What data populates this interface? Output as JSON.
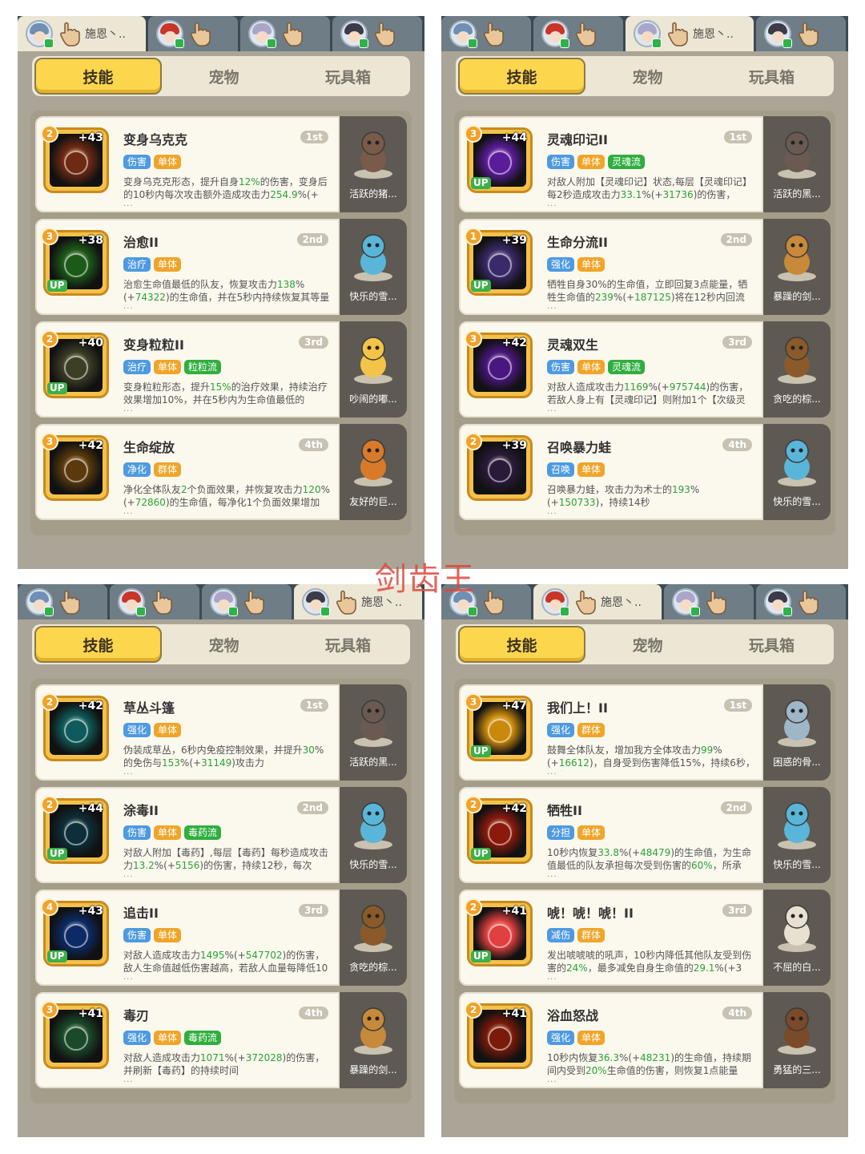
{
  "nav_tabs": [
    "技能",
    "宠物",
    "玩具箱"
  ],
  "watermark": "剑齿王",
  "panels": [
    {
      "active_char": 0,
      "char_name": "施恩丶..",
      "cards": [
        {
          "name": "变身乌克克",
          "rank": "1st",
          "level": "2",
          "plus": "+43",
          "up": false,
          "tags": [
            [
              "伤害",
              "blue"
            ],
            [
              "单体",
              "orange"
            ]
          ],
          "desc": [
            [
              "变身乌克克形态，提升自身",
              ""
            ],
            [
              "12%",
              "g"
            ],
            [
              "的伤害，变身后的10秒内每次攻击额外造成攻击力",
              ""
            ],
            [
              "254.9",
              "g"
            ],
            [
              "%(+",
              ""
            ]
          ],
          "pet": "活跃的猪...",
          "icon_color": "#6e2a12",
          "pet_color": "#7a5a48"
        },
        {
          "name": "治愈II",
          "rank": "2nd",
          "level": "3",
          "plus": "+38",
          "up": true,
          "tags": [
            [
              "治疗",
              "blue"
            ],
            [
              "单体",
              "orange"
            ]
          ],
          "desc": [
            [
              "治愈生命值最低的队友，恢复攻击力",
              ""
            ],
            [
              "138",
              "g"
            ],
            [
              "%(+",
              ""
            ],
            [
              "74322",
              "g"
            ],
            [
              ")的生命值，并在5秒内持续恢复其等量的",
              ""
            ]
          ],
          "pet": "快乐的雪...",
          "icon_color": "#1c5a18",
          "pet_color": "#59b6d8"
        },
        {
          "name": "变身粒粒II",
          "rank": "3rd",
          "level": "2",
          "plus": "+40",
          "up": true,
          "tags": [
            [
              "治疗",
              "blue"
            ],
            [
              "单体",
              "orange"
            ],
            [
              "粒粒流",
              "green"
            ]
          ],
          "desc": [
            [
              "变身粒粒形态，提升",
              ""
            ],
            [
              "15%",
              "g"
            ],
            [
              "的治疗效果，持续治疗效果增加10%，并在5秒内为生命值最低的",
              ""
            ]
          ],
          "pet": "吵闹的嘟...",
          "icon_color": "#3c3e26",
          "pet_color": "#f3c447"
        },
        {
          "name": "生命绽放",
          "rank": "4th",
          "level": "3",
          "plus": "+42",
          "up": false,
          "tags": [
            [
              "净化",
              "blue"
            ],
            [
              "群体",
              "orange"
            ]
          ],
          "desc": [
            [
              "净化全体队友",
              ""
            ],
            [
              "2",
              "g"
            ],
            [
              "个负面效果，并恢复攻击力",
              ""
            ],
            [
              "120",
              "g"
            ],
            [
              "%(+",
              ""
            ],
            [
              "72860",
              "g"
            ],
            [
              ")的生命值，每净化1个负面效果增加",
              ""
            ]
          ],
          "pet": "友好的巨...",
          "icon_color": "#5a3a0c",
          "pet_color": "#d97a2a"
        }
      ]
    },
    {
      "active_char": 2,
      "char_name": "施恩丶..",
      "cards": [
        {
          "name": "灵魂印记II",
          "rank": "1st",
          "level": "3",
          "plus": "+44",
          "up": true,
          "tags": [
            [
              "伤害",
              "blue"
            ],
            [
              "单体",
              "orange"
            ],
            [
              "灵魂流",
              "green"
            ]
          ],
          "desc": [
            [
              "对敌人附加【灵魂印记】状态,每层【灵魂印记】每2秒造成攻击力",
              ""
            ],
            [
              "33.1",
              "g"
            ],
            [
              "%(+",
              ""
            ],
            [
              "31736",
              "g"
            ],
            [
              ")的伤害，",
              ""
            ]
          ],
          "pet": "活跃的黑...",
          "icon_color": "#5a1c9a",
          "pet_color": "#6a5a52"
        },
        {
          "name": "生命分流II",
          "rank": "2nd",
          "level": "1",
          "plus": "+39",
          "up": true,
          "tags": [
            [
              "强化",
              "blue"
            ],
            [
              "单体",
              "orange"
            ]
          ],
          "desc": [
            [
              "牺牲自身30%的生命值，立即回复3点能量，牺牲生命值的",
              ""
            ],
            [
              "239",
              "g"
            ],
            [
              "%(+",
              ""
            ],
            [
              "187125",
              "g"
            ],
            [
              ")将在12秒内回流",
              ""
            ]
          ],
          "pet": "暴躁的剑...",
          "icon_color": "#3a2a6a",
          "pet_color": "#c7893a"
        },
        {
          "name": "灵魂双生",
          "rank": "3rd",
          "level": "3",
          "plus": "+42",
          "up": false,
          "tags": [
            [
              "伤害",
              "blue"
            ],
            [
              "单体",
              "orange"
            ],
            [
              "灵魂流",
              "green"
            ]
          ],
          "desc": [
            [
              "对敌人造成攻击力",
              ""
            ],
            [
              "1169",
              "g"
            ],
            [
              "%(+",
              ""
            ],
            [
              "975744",
              "g"
            ],
            [
              ")的伤害，若敌人身上有【灵魂印记】则附加1个【次级灵",
              ""
            ]
          ],
          "pet": "贪吃的棕...",
          "icon_color": "#4a1680",
          "pet_color": "#8b5a2a"
        },
        {
          "name": "召唤暴力蛙",
          "rank": "4th",
          "level": "2",
          "plus": "+39",
          "up": false,
          "tags": [
            [
              "召唤",
              "blue"
            ],
            [
              "单体",
              "orange"
            ]
          ],
          "desc": [
            [
              "召唤暴力蛙，攻击力为术士的",
              ""
            ],
            [
              "193",
              "g"
            ],
            [
              "%(+",
              ""
            ],
            [
              "150733",
              "g"
            ],
            [
              ")，持续14秒",
              ""
            ]
          ],
          "pet": "快乐的雪...",
          "icon_color": "#2a1a3a",
          "pet_color": "#59b6d8"
        }
      ]
    },
    {
      "active_char": 3,
      "char_name": "施恩丶..",
      "cards": [
        {
          "name": "草丛斗篷",
          "rank": "1st",
          "level": "2",
          "plus": "+42",
          "up": false,
          "tags": [
            [
              "强化",
              "blue"
            ],
            [
              "单体",
              "orange"
            ]
          ],
          "desc": [
            [
              "伪装成草丛，6秒内免疫控制效果，并提升",
              ""
            ],
            [
              "30",
              "g"
            ],
            [
              "%的免伤与",
              ""
            ],
            [
              "153",
              "g"
            ],
            [
              "%(+",
              ""
            ],
            [
              "31149",
              "g"
            ],
            [
              ")攻击力",
              ""
            ]
          ],
          "pet": "活跃的黑...",
          "icon_color": "#0f5a5a",
          "pet_color": "#6a5a52"
        },
        {
          "name": "涂毒II",
          "rank": "2nd",
          "level": "2",
          "plus": "+44",
          "up": true,
          "tags": [
            [
              "伤害",
              "blue"
            ],
            [
              "单体",
              "orange"
            ],
            [
              "毒药流",
              "green"
            ]
          ],
          "desc": [
            [
              "对敌人附加【毒药】,每层【毒药】每秒造成攻击力",
              ""
            ],
            [
              "13.2",
              "g"
            ],
            [
              "%(+",
              ""
            ],
            [
              "5156",
              "g"
            ],
            [
              ")的伤害，持续12秒，每次",
              ""
            ]
          ],
          "pet": "快乐的雪...",
          "icon_color": "#0d2f3a",
          "pet_color": "#59b6d8"
        },
        {
          "name": "追击II",
          "rank": "3rd",
          "level": "4",
          "plus": "+43",
          "up": true,
          "tags": [
            [
              "伤害",
              "blue"
            ],
            [
              "单体",
              "orange"
            ]
          ],
          "desc": [
            [
              "对敌人造成攻击力",
              ""
            ],
            [
              "1495",
              "g"
            ],
            [
              "%(+",
              ""
            ],
            [
              "547702",
              "g"
            ],
            [
              ")的伤害，敌人生命值越低伤害越高，若敌人血量每降低10",
              ""
            ]
          ],
          "pet": "贪吃的棕...",
          "icon_color": "#0c2a66",
          "pet_color": "#8b5a2a"
        },
        {
          "name": "毒刃",
          "rank": "4th",
          "level": "3",
          "plus": "+41",
          "up": false,
          "tags": [
            [
              "强化",
              "blue"
            ],
            [
              "单体",
              "orange"
            ],
            [
              "毒药流",
              "green"
            ]
          ],
          "desc": [
            [
              "对敌人造成攻击力",
              ""
            ],
            [
              "1071",
              "g"
            ],
            [
              "%(+",
              ""
            ],
            [
              "372028",
              "g"
            ],
            [
              ")的伤害，并刷新【毒药】的持续时间",
              ""
            ]
          ],
          "pet": "暴躁的剑...",
          "icon_color": "#1a4a2a",
          "pet_color": "#c7893a"
        }
      ]
    },
    {
      "active_char": 1,
      "char_name": "施恩丶..",
      "cards": [
        {
          "name": "我们上！II",
          "rank": "1st",
          "level": "3",
          "plus": "+47",
          "up": true,
          "tags": [
            [
              "强化",
              "blue"
            ],
            [
              "群体",
              "orange"
            ]
          ],
          "desc": [
            [
              "鼓舞全体队友，增加我方全体攻击力",
              ""
            ],
            [
              "99",
              "g"
            ],
            [
              "%(+",
              ""
            ],
            [
              "16612",
              "g"
            ],
            [
              ")，自身受到伤害降低15%，持续6秒，且自",
              ""
            ]
          ],
          "pet": "困惑的骨...",
          "icon_color": "#c98a0c",
          "pet_color": "#9fb6c6"
        },
        {
          "name": "牺牲II",
          "rank": "2nd",
          "level": "2",
          "plus": "+42",
          "up": true,
          "tags": [
            [
              "分担",
              "blue"
            ],
            [
              "单体",
              "orange"
            ]
          ],
          "desc": [
            [
              "10秒内恢复",
              ""
            ],
            [
              "33.8",
              "g"
            ],
            [
              "%(+",
              ""
            ],
            [
              "48479",
              "g"
            ],
            [
              ")的生命值，为生命值最低的队友承担每次受到伤害的",
              ""
            ],
            [
              "60%",
              "g"
            ],
            [
              "，所承",
              ""
            ]
          ],
          "pet": "快乐的雪...",
          "icon_color": "#8a1a0c",
          "pet_color": "#59b6d8"
        },
        {
          "name": "唬！唬！唬！II",
          "rank": "3rd",
          "level": "2",
          "plus": "+41",
          "up": true,
          "tags": [
            [
              "减伤",
              "blue"
            ],
            [
              "群体",
              "orange"
            ]
          ],
          "desc": [
            [
              "发出唬唬唬的吼声，10秒内降低其他队友受到伤害的",
              ""
            ],
            [
              "24%",
              "g"
            ],
            [
              "，最多减免自身生命值的",
              ""
            ],
            [
              "29.1",
              "g"
            ],
            [
              "%(+3",
              ""
            ]
          ],
          "pet": "不屈的白...",
          "icon_color": "#e04040",
          "pet_color": "#e8e0d0"
        },
        {
          "name": "浴血怒战",
          "rank": "4th",
          "level": "2",
          "plus": "+41",
          "up": false,
          "tags": [
            [
              "强化",
              "blue"
            ],
            [
              "单体",
              "orange"
            ]
          ],
          "desc": [
            [
              "10秒内恢复",
              ""
            ],
            [
              "36.3",
              "g"
            ],
            [
              "%(+",
              ""
            ],
            [
              "48231",
              "g"
            ],
            [
              ")的生命值，持续期间内受到",
              ""
            ],
            [
              "20%",
              "g"
            ],
            [
              "生命值的伤害，则恢复1点能量",
              ""
            ]
          ],
          "pet": "勇猛的三...",
          "icon_color": "#7a1a0a",
          "pet_color": "#7a4a2a"
        }
      ]
    }
  ],
  "char_hair_colors": [
    "#6f8fb4",
    "#c8362a",
    "#a9a6c9",
    "#3b3b4a"
  ]
}
